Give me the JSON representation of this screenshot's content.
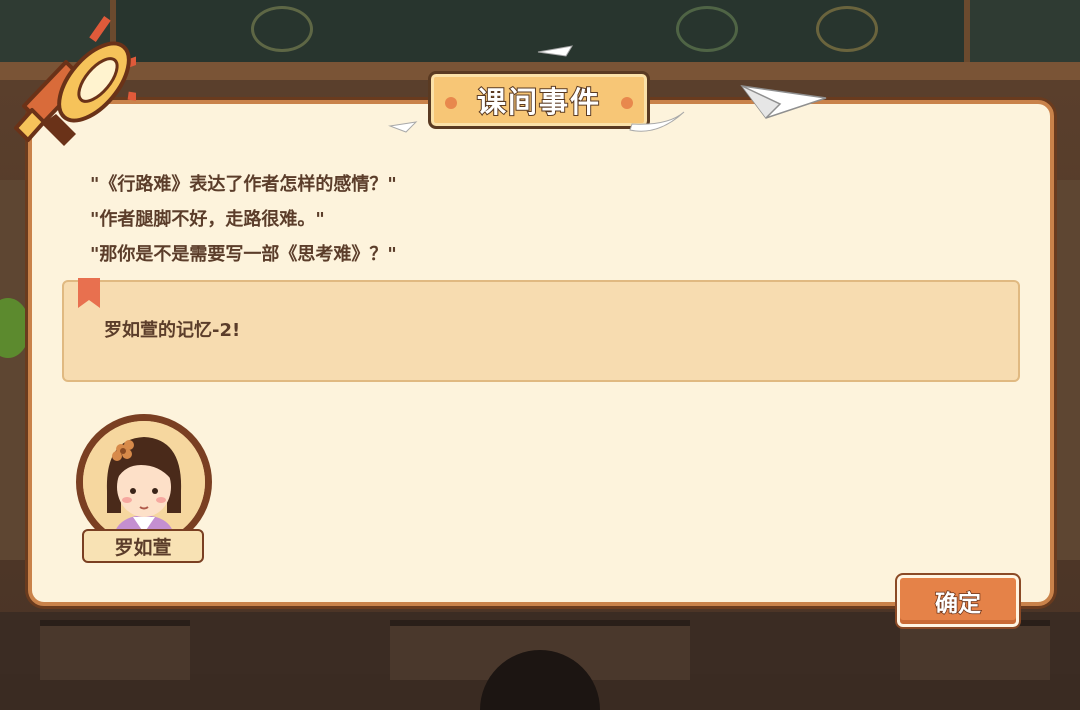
{
  "dialog": {
    "title": "课间事件",
    "quotes": [
      "\"《行路难》表达了作者怎样的感情？\"",
      "\"作者腿脚不好，走路很难。\"",
      "\"那你是不是需要写一部《思考难》？\""
    ],
    "result": "罗如萱的记忆-2!",
    "character_name": "罗如萱",
    "confirm_label": "确定"
  },
  "colors": {
    "panel": "#fdf3dc",
    "panel_border": "#c9824a",
    "title_plate": "#f7c676",
    "memory_box": "#f7dcb0",
    "confirm_button": "#e58248",
    "text": "#5b3d2a"
  },
  "icons": [
    "megaphone-icon",
    "paper-plane-icon",
    "bookmark-icon",
    "character-portrait"
  ]
}
